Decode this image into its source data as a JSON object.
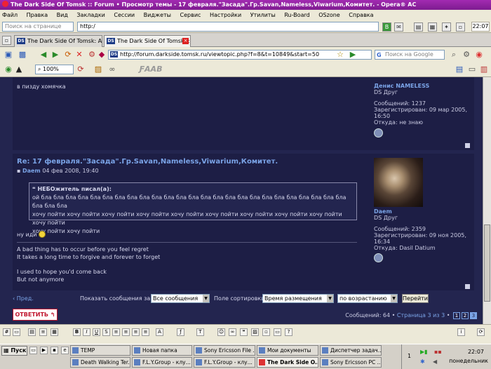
{
  "window": {
    "title": "The Dark Side Of Tomsk :: Forum • Просмотр темы - 17 февраля.\"Засада\".Гр.Savan,Nameless,Viwarium,Комитет. - Opera® AC"
  },
  "menu": [
    "Файл",
    "Правка",
    "Вид",
    "Закладки",
    "Сессии",
    "Виджеты",
    "Сервис",
    "Настройки",
    "Утилиты",
    "Ru-Board",
    "OSzone",
    "Справка"
  ],
  "topbar": {
    "search_placeholder": "Поиск на странице",
    "address_value": "http:/",
    "clock": "22:07"
  },
  "tabs": [
    {
      "label": "The Dark Side Of Tomsk: A...",
      "favicon": "DS",
      "active": false
    },
    {
      "label": "The Dark Side Of Tomsk :: ...",
      "favicon": "DS",
      "active": true
    }
  ],
  "nav": {
    "url": "http://forum.darkside.tomsk.ru/viewtopic.php?f=8&t=10849&start=50",
    "google_placeholder": "Поиск на Google"
  },
  "toolbar2": {
    "zoom": "100%",
    "letters": "ƑAAB"
  },
  "post1": {
    "text": "в пизду хомячка",
    "author": "Денис NAMELESS",
    "rank": "DS Друг",
    "messages": "Сообщений: 1237",
    "registered": "Зарегистрирован: 09 мар 2005,",
    "registered_time": "16:50",
    "from": "Откуда: не знаю"
  },
  "post2": {
    "title": "Re: 17 февраля.\"Засада\".Гр.Savan,Nameless,Viwarium,Комитет.",
    "author": "Daem",
    "date": "04 фев 2008, 19:40",
    "quote_header": "НЕБОжитель писал(а):",
    "quote_line1": "ой бла бла бла бла бла бла бла бла бла бла бла бла бла бла бла бла бла бла бла бла бла бла бла бла бла бла бла бла",
    "quote_line2": "хочу пойти хочу пойти хочу пойти хочу пойти хочу пойти хочу пойти хочу пойти хочу пойти хочу пойти хочу пойти",
    "quote_line3": "хочу пойти хочу пойти",
    "reply": "ну иди",
    "sig1": "A bad thing has to occur before you feel regret",
    "sig2": "It takes a long time to forgive and forever to forget",
    "sig3": "I used to hope you'd come back",
    "sig4": "But not anymore",
    "profile_name": "Daem",
    "profile_rank": "DS Друг",
    "profile_messages": "Сообщений: 2359",
    "profile_registered": "Зарегистрирован: 09 ноя 2005,",
    "profile_registered_time": "16:34",
    "profile_from": "Откуда: Dasil Datium"
  },
  "controls": {
    "prev": "Пред.",
    "show_label": "Показать сообщения за:",
    "show_value": "Все сообщения",
    "sort_label": "Поле сортировки",
    "sort_value": "Время размещения",
    "order_value": "по возрастанию",
    "go": "Перейти"
  },
  "reply_button": "ОТВЕТИТЬ",
  "pagination": {
    "count": "Сообщений: 64",
    "page_text": "Страница 3 из 3",
    "pages": [
      "1",
      "2",
      "3"
    ]
  },
  "taskbar": {
    "start": "Пуск",
    "row1": [
      "TEMP",
      "Новая папка",
      "Sony Ericsson File ...",
      "Мои документы",
      "Диспетчер задач..."
    ],
    "row2": [
      "Death Walking Ter...",
      "F.L.Y.Group - клу...",
      "F.L.Y.Group - клу...",
      "The Dark Side O...",
      "Sony Ericsson PC ..."
    ],
    "time": "22:07",
    "day": "понедельник"
  }
}
